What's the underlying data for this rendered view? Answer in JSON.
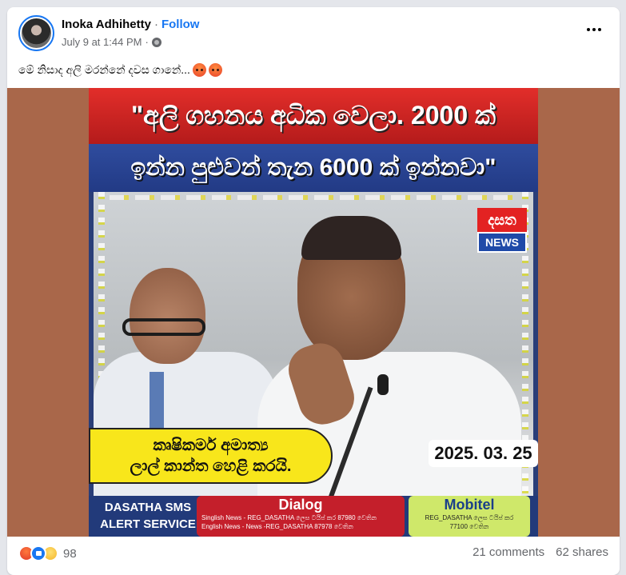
{
  "post": {
    "author": "Inoka Adhihetty",
    "separator": "·",
    "follow_label": "Follow",
    "timestamp": "July 9 at 1:44 PM",
    "meta_separator": "·",
    "privacy_icon": "globe-icon",
    "more_icon": "more-options-icon",
    "caption_text": "මේ නිසාද අලි මරන්නේ දවස ගානේ...",
    "caption_emojis": [
      "angry-emoji",
      "angry-emoji"
    ]
  },
  "poster": {
    "headline_line1": "\"අලි ගහනය අධික වෙලා. 2000 ක්",
    "headline_line2": "ඉන්න පුළුවන් තැන 6000 ක් ඉන්නවා\"",
    "logo_top": "දසත",
    "logo_bottom": "NEWS",
    "banner_line1": "කෘෂිකර්ම අමාත්‍ය",
    "banner_line2": "ලාල් කාන්ත හෙළි කරයි.",
    "date": "2025. 03. 25",
    "sms_line1": "DASATHA SMS",
    "sms_line2": "ALERT SERVICE",
    "dialog_title": "Dialog",
    "dialog_line1": "Singlish News - REG_DASATHA ලෙස ටයිප් කර 87980 වෙතින",
    "dialog_line2": "English News - News -REG_DASATHA 87978 වෙතින",
    "mobitel_title": "Mobitel",
    "mobitel_line1": "REG_DASATHA ලෙස ටයිප් කර",
    "mobitel_line2": "77100 වෙතින"
  },
  "engagement": {
    "reaction_icons": [
      "angry-reaction-icon",
      "like-reaction-icon",
      "sad-reaction-icon"
    ],
    "reaction_count": "98",
    "comments": "21 comments",
    "shares": "62 shares"
  },
  "colors": {
    "accent": "#1877f2",
    "secondary_text": "#65676b",
    "media_background": "#a9674a"
  }
}
